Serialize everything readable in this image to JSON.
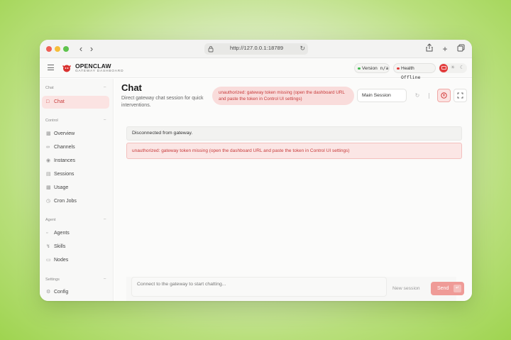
{
  "browser": {
    "url": "http://127.0.0.1:18789"
  },
  "header": {
    "brand": "OPENCLAW",
    "brand_subtitle": "GATEWAY DASHBOARD",
    "version_label": "Version",
    "version_value": "n/a",
    "health_label": "Health",
    "health_value": "Offline",
    "colors": {
      "accent": "#e23b3b",
      "version_dot": "#3fb950",
      "health_dot": "#e23b3b"
    }
  },
  "sidebar": {
    "sections": [
      {
        "label": "Chat",
        "items": [
          {
            "label": "Chat",
            "icon": "chat-bubble-icon",
            "active": true
          }
        ]
      },
      {
        "label": "Control",
        "items": [
          {
            "label": "Overview",
            "icon": "bar-chart-icon"
          },
          {
            "label": "Channels",
            "icon": "link-icon"
          },
          {
            "label": "Instances",
            "icon": "radio-icon"
          },
          {
            "label": "Sessions",
            "icon": "document-icon"
          },
          {
            "label": "Usage",
            "icon": "bar-chart-icon"
          },
          {
            "label": "Cron Jobs",
            "icon": "clock-icon"
          }
        ]
      },
      {
        "label": "Agent",
        "items": [
          {
            "label": "Agents",
            "icon": "folder-icon"
          },
          {
            "label": "Skills",
            "icon": "lightning-icon"
          },
          {
            "label": "Nodes",
            "icon": "monitor-icon"
          }
        ]
      },
      {
        "label": "Settings",
        "items": [
          {
            "label": "Config",
            "icon": "gear-icon"
          }
        ]
      }
    ]
  },
  "main": {
    "title": "Chat",
    "subtitle": "Direct gateway chat session for quick interventions.",
    "error_pill": "unauthorized: gateway token missing (open the dashboard URL and paste the token in Control UI settings)",
    "session_select": "Main Session",
    "notice": "Disconnected from gateway.",
    "error_box": "unauthorized: gateway token missing (open the dashboard URL and paste the token in Control UI settings)",
    "compose_placeholder": "Connect to the gateway to start chatting...",
    "new_session_label": "New session",
    "send_label": "Send"
  }
}
